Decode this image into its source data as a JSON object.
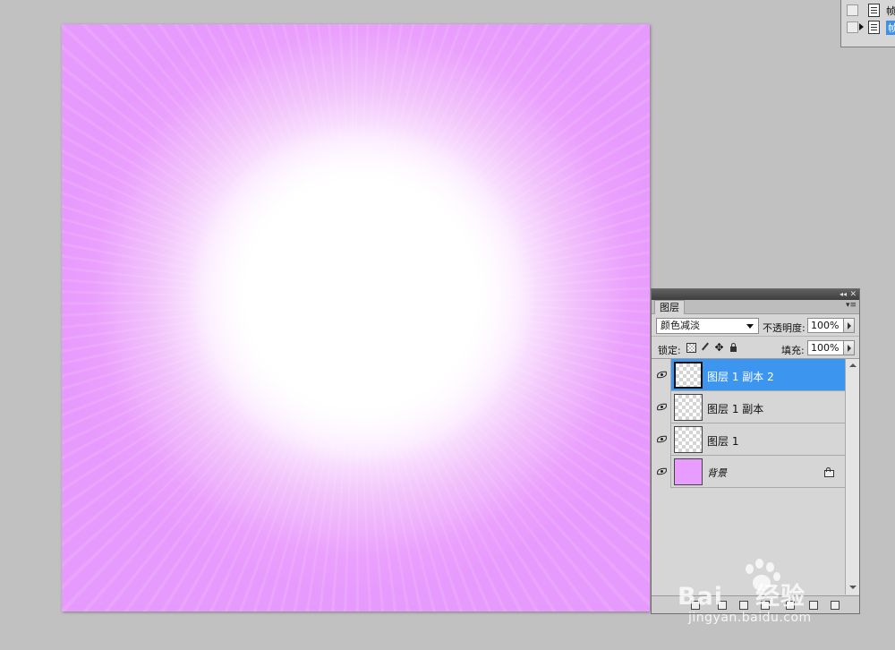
{
  "mini_panel": {
    "items": [
      {
        "label": "帧",
        "selected": false
      },
      {
        "label": "帧",
        "selected": true
      }
    ]
  },
  "layers_panel": {
    "tab_label": "图层",
    "collapse_icon": "◂◂",
    "close_icon": "✕",
    "menu_icon": "▾≡",
    "blend_mode": "颜色减淡",
    "opacity_label": "不透明度:",
    "opacity_value": "100%",
    "lock_label": "锁定:",
    "fill_label": "填充:",
    "fill_value": "100%",
    "layers": [
      {
        "name": "图层 1 副本 2",
        "selected": true,
        "thumb": "transparent"
      },
      {
        "name": "图层 1 副本",
        "selected": false,
        "thumb": "transparent"
      },
      {
        "name": "图层 1",
        "selected": false,
        "thumb": "transparent"
      },
      {
        "name": "背景",
        "selected": false,
        "thumb": "color",
        "locked": true
      }
    ]
  },
  "canvas": {
    "background_color": "#e79afd",
    "center_color": "#ffffff"
  },
  "watermark": {
    "brand": "Bai",
    "brand_cn": "经验",
    "url": "jingyan.baidu.com"
  }
}
